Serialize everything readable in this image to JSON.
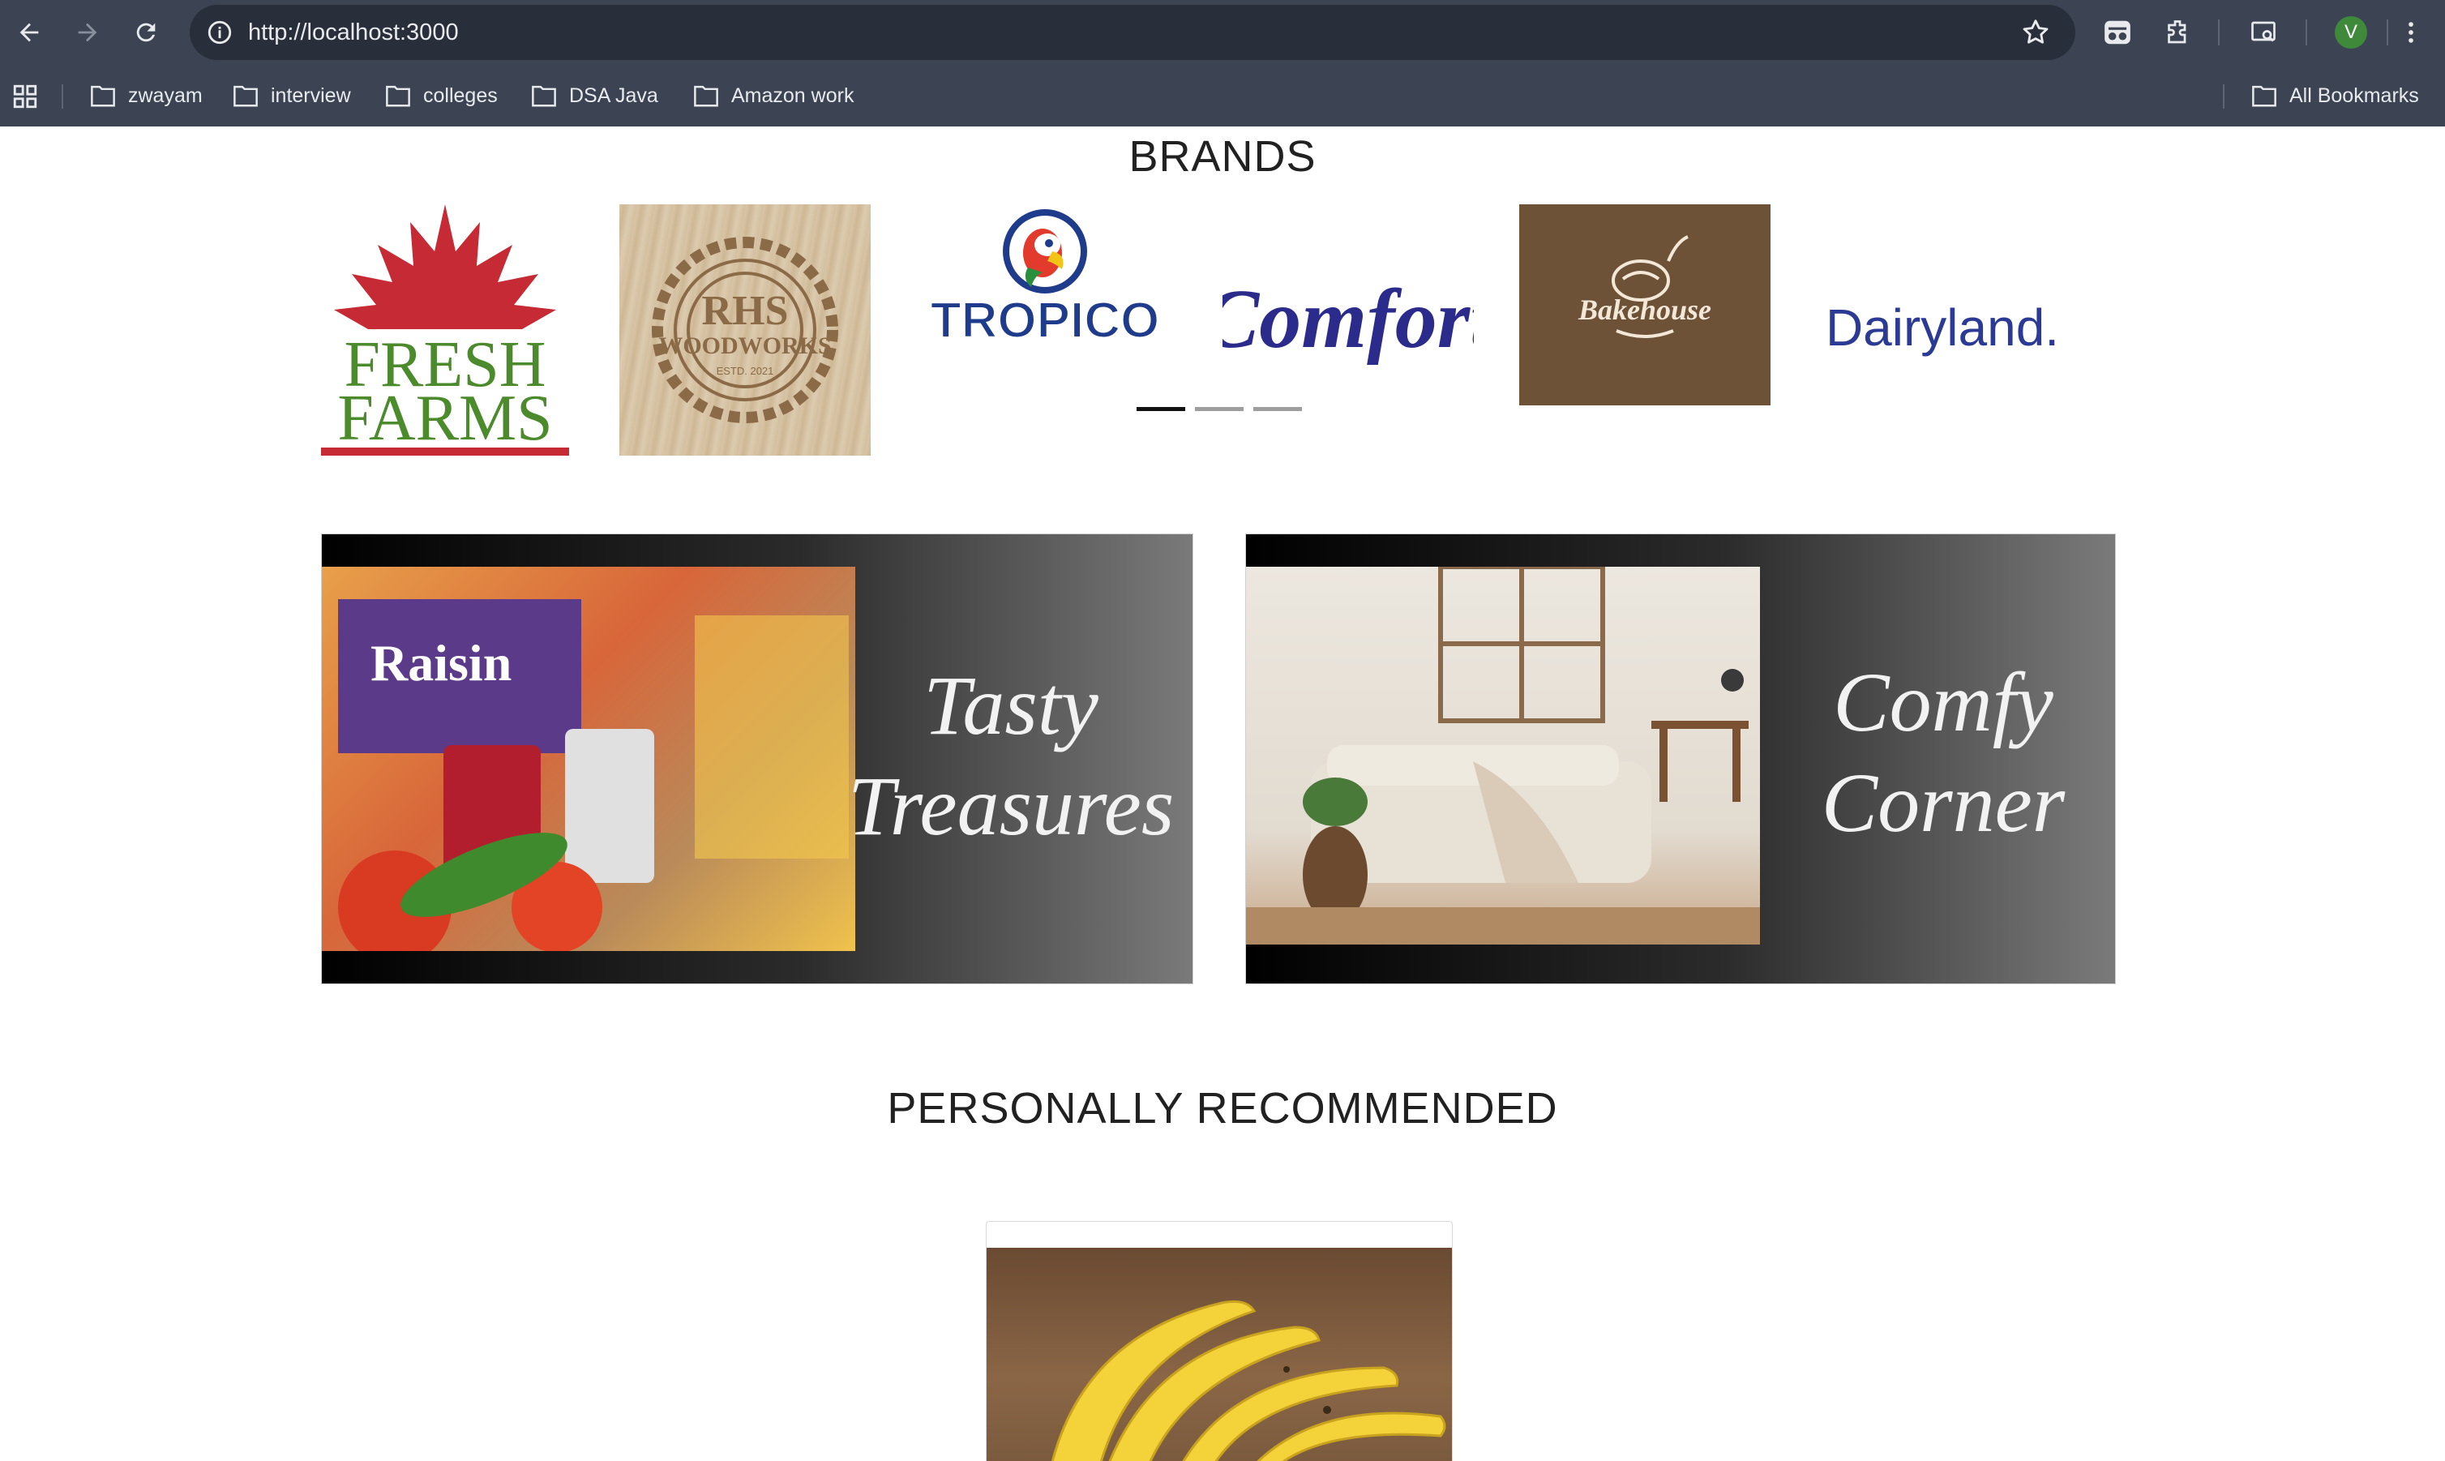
{
  "browser": {
    "url": "http://localhost:3000",
    "profile_initial": "V",
    "bookmarks": [
      "zwayam",
      "interview",
      "colleges",
      "DSA Java",
      "Amazon work"
    ],
    "all_bookmarks_label": "All Bookmarks"
  },
  "brands": {
    "title": "BRANDS",
    "logos": [
      {
        "line1": "FRESH",
        "line2": "FARMS"
      },
      {
        "line1": "RHS",
        "line2": "WOODWORKS",
        "line3": "ESTD. 2021"
      },
      {
        "line1": "TROPICO"
      },
      {
        "line1": "Comfort"
      },
      {
        "line1": "Bakehouse"
      },
      {
        "line1": "Dairyland."
      }
    ],
    "carousel_pages": 3,
    "active_page": 0
  },
  "banners": [
    {
      "line1": "Tasty",
      "line2": "Treasures"
    },
    {
      "line1": "Comfy",
      "line2": "Corner"
    }
  ],
  "recommended": {
    "title": "PERSONALLY RECOMMENDED"
  },
  "colors": {
    "chrome_bg": "#3c4453",
    "omnibox_bg": "#282e3a",
    "fresh_red": "#c62a34",
    "fresh_green": "#4b8b2c",
    "bakehouse_bg": "#6d5238",
    "brand_navy": "#2b2b8c"
  }
}
